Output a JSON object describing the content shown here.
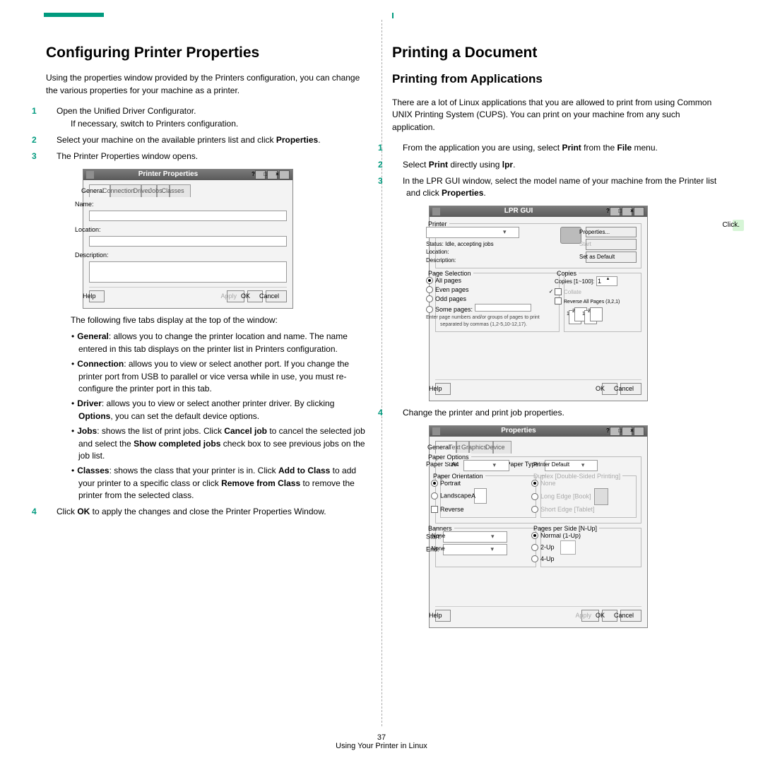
{
  "pageNumber": "37",
  "footerText": "Using Your Printer in Linux",
  "left": {
    "h1": "Configuring Printer Properties",
    "intro": "Using the properties window provided by the Printers configuration, you can change the various properties for your machine as a printer.",
    "step1": "Open the Unified Driver Configurator.",
    "step1_note": "If necessary, switch to Printers configuration.",
    "step2_a": "Select your machine on the available printers list and click ",
    "step2_b": "Properties",
    "step2_c": ".",
    "step3": "The Printer Properties window opens.",
    "win1": {
      "title": "Printer Properties",
      "tabs": [
        "General",
        "Connection",
        "Driver",
        "Jobs",
        "Classes"
      ],
      "fields": {
        "name": "Name:",
        "location": "Location:",
        "description": "Description:"
      },
      "buttons": {
        "help": "Help",
        "apply": "Apply",
        "ok": "OK",
        "cancel": "Cancel"
      }
    },
    "afterWin": "The following five tabs display at the top of the window:",
    "bullets": {
      "general_b": "General",
      "general_t": ": allows you to change the printer location and name. The name entered in this tab displays on the printer list in Printers configuration.",
      "connection_b": "Connection",
      "connection_t": ": allows you to view or select another port. If you change the printer port from USB to parallel or vice versa while in use, you must re-configure the printer port in this tab.",
      "driver_b": "Driver",
      "driver_t1": ": allows you to view or select another printer driver. By clicking ",
      "driver_opt": "Options",
      "driver_t2": ", you can set the default device options.",
      "jobs_b": "Jobs",
      "jobs_t1": ": shows the list of print jobs. Click ",
      "jobs_cancel": "Cancel job",
      "jobs_t2": " to cancel the selected job and select the ",
      "jobs_show": "Show completed jobs",
      "jobs_t3": " check box to see previous jobs on the job list.",
      "classes_b": "Classes",
      "classes_t1": ": shows the class that your printer is in. Click ",
      "classes_add": "Add to Class",
      "classes_t2": " to add your printer to a specific class or click ",
      "classes_rem": "Remove from Class",
      "classes_t3": " to remove the printer from the selected class."
    },
    "step4_a": "Click ",
    "step4_b": "OK",
    "step4_c": " to apply the changes and close the Printer Properties Window."
  },
  "right": {
    "h1": "Printing a Document",
    "h2": "Printing from Applications",
    "intro": "There are a lot of Linux applications that you are allowed to print from using Common UNIX Printing System (CUPS). You can print on your machine from any such application.",
    "step1_a": "From the application you are using, select ",
    "step1_b": "Print",
    "step1_c": " from the ",
    "step1_d": "File",
    "step1_e": " menu.",
    "step2_a": "Select ",
    "step2_b": "Print",
    "step2_c": " directly using ",
    "step2_d": "lpr",
    "step2_e": ".",
    "step3_a": "In the LPR GUI window, select the model name of your machine from the Printer list and click ",
    "step3_b": "Properties",
    "step3_c": ".",
    "clickLabel": "Click.",
    "lpr": {
      "title": "LPR GUI",
      "printerGroup": "Printer",
      "status": "Status: Idle, accepting jobs",
      "location": "Location:",
      "description": "Description:",
      "btnProps": "Properties...",
      "btnStart": "Start",
      "btnDefault": "Set as Default",
      "pageSel": "Page Selection",
      "allPages": "All pages",
      "evenPages": "Even pages",
      "oddPages": "Odd pages",
      "somePages": "Some pages:",
      "someHint": "Enter page numbers and/or groups of pages to print separated by commas (1,2-5,10-12,17).",
      "copies": "Copies",
      "copiesLbl": "Copies [1~100]:",
      "copiesVal": "1",
      "collate": "Collate",
      "reverse": "Reverse All Pages (3,2,1)",
      "help": "Help",
      "ok": "OK",
      "cancel": "Cancel"
    },
    "step4": "Change the printer and print job properties.",
    "props": {
      "title": "Properties",
      "tabs": [
        "General",
        "Text",
        "Graphics",
        "Device"
      ],
      "paperOptions": "Paper Options",
      "paperSize": "Paper Size:",
      "paperSizeVal": "A4",
      "paperType": "Paper Type:",
      "paperTypeVal": "Printer Default",
      "orientation": "Paper Orientation",
      "portrait": "Portrait",
      "landscape": "Landscape",
      "reverse": "Reverse",
      "duplex": "Duplex [Double-Sided Printing]",
      "dupNone": "None",
      "dupLong": "Long Edge [Book]",
      "dupShort": "Short Edge [Tablet]",
      "banners": "Banners",
      "startLbl": "Start:",
      "endLbl": "End:",
      "none": "None",
      "nup": "Pages per Side [N-Up]",
      "nup1": "Normal (1-Up)",
      "nup2": "2-Up",
      "nup4": "4-Up",
      "help": "Help",
      "apply": "Apply",
      "ok": "OK",
      "cancel": "Cancel"
    }
  }
}
